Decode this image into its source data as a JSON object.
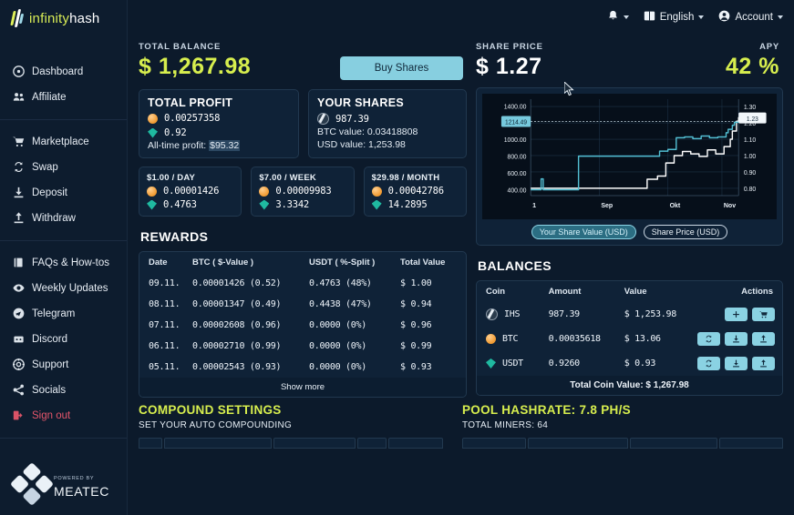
{
  "brand": {
    "name_a": "infinity",
    "name_b": "hash"
  },
  "sidebar": {
    "groups": [
      {
        "items": [
          {
            "label": "Dashboard",
            "icon": "dashboard-icon"
          },
          {
            "label": "Affiliate",
            "icon": "users-icon"
          }
        ]
      },
      {
        "items": [
          {
            "label": "Marketplace",
            "icon": "cart-icon"
          },
          {
            "label": "Swap",
            "icon": "swap-icon"
          },
          {
            "label": "Deposit",
            "icon": "download-icon"
          },
          {
            "label": "Withdraw",
            "icon": "upload-icon"
          }
        ]
      },
      {
        "items": [
          {
            "label": "FAQs & How-tos",
            "icon": "book-icon"
          },
          {
            "label": "Weekly Updates",
            "icon": "eye-icon"
          },
          {
            "label": "Telegram",
            "icon": "telegram-icon"
          },
          {
            "label": "Discord",
            "icon": "discord-icon"
          },
          {
            "label": "Support",
            "icon": "lifebuoy-icon"
          },
          {
            "label": "Socials",
            "icon": "share-icon"
          },
          {
            "label": "Sign out",
            "icon": "signout-icon",
            "danger": true
          }
        ]
      }
    ],
    "footer": {
      "powered_by": "POWERED BY",
      "vendor": "MEATEC"
    }
  },
  "topbar": {
    "notifications_icon": "bell-icon",
    "language": "English",
    "language_icon": "language-icon",
    "account": "Account",
    "account_icon": "user-circle-icon"
  },
  "balance_panel": {
    "label": "TOTAL BALANCE",
    "value": "$ 1,267.98",
    "buy_button": "Buy Shares"
  },
  "share_panel": {
    "label": "SHARE PRICE",
    "value": "$ 1.27",
    "apy_label": "APY",
    "apy_value": "42 %"
  },
  "total_profit": {
    "title": "TOTAL PROFIT",
    "btc": "0.00257358",
    "usdt": "0.92",
    "all_time_label": "All-time profit: ",
    "all_time_value": "$95.32"
  },
  "your_shares": {
    "title": "YOUR SHARES",
    "shares": "987.39",
    "btc_value": "BTC value: 0.03418808",
    "usd_value": "USD value: 1,253.98"
  },
  "rates": [
    {
      "title": "$1.00 / DAY",
      "btc": "0.00001426",
      "usdt": "0.4763"
    },
    {
      "title": "$7.00 / WEEK",
      "btc": "0.00009983",
      "usdt": "3.3342"
    },
    {
      "title": "$29.98 / MONTH",
      "btc": "0.00042786",
      "usdt": "14.2895"
    }
  ],
  "rewards": {
    "title": "REWARDS",
    "columns": [
      "Date",
      "BTC ( $-Value )",
      "USDT ( %-Split )",
      "Total Value"
    ],
    "rows": [
      [
        "09.11.",
        "0.00001426  (0.52)",
        "0.4763  (48%)",
        "$ 1.00"
      ],
      [
        "08.11.",
        "0.00001347  (0.49)",
        "0.4438  (47%)",
        "$ 0.94"
      ],
      [
        "07.11.",
        "0.00002608  (0.96)",
        "0.0000  (0%)",
        "$ 0.96"
      ],
      [
        "06.11.",
        "0.00002710  (0.99)",
        "0.0000  (0%)",
        "$ 0.99"
      ],
      [
        "05.11.",
        "0.00002543  (0.93)",
        "0.0000  (0%)",
        "$ 0.93"
      ]
    ],
    "show_more": "Show more"
  },
  "balances": {
    "title": "BALANCES",
    "columns": [
      "Coin",
      "Amount",
      "Value",
      "Actions"
    ],
    "rows": [
      {
        "coin": "IHS",
        "icon": "ihs-coin-icon",
        "amount": "987.39",
        "value": "$ 1,253.98",
        "actions": [
          "plus-icon",
          "cart-icon"
        ]
      },
      {
        "coin": "BTC",
        "icon": "btc-coin-icon",
        "amount": "0.00035618",
        "value": "$ 13.06",
        "actions": [
          "swap-icon",
          "download-icon",
          "upload-icon"
        ]
      },
      {
        "coin": "USDT",
        "icon": "usdt-coin-icon",
        "amount": "0.9260",
        "value": "$ 0.93",
        "actions": [
          "swap-icon",
          "download-icon",
          "upload-icon"
        ]
      }
    ],
    "total": "Total Coin Value: $ 1,267.98"
  },
  "compound": {
    "title": "COMPOUND SETTINGS",
    "subtitle": "SET YOUR AUTO COMPOUNDING"
  },
  "pool": {
    "title": "POOL HASHRATE: 7.8 PH/S",
    "subtitle": "TOTAL MINERS: 64"
  },
  "colors": {
    "lime": "#d7ee4e",
    "cyan": "#5cc3d6",
    "panel": "#0f2237",
    "background": "#0c1a2b",
    "sidebar": "#0d1c2e",
    "danger": "#e5566b"
  },
  "chart_data": {
    "type": "line",
    "title": "",
    "xlabel": "",
    "ylabel": "",
    "grid": true,
    "legend_position": "bottom",
    "x_ticks": [
      "1",
      "Sep",
      "Okt",
      "Nov"
    ],
    "y_left_ticks": [
      "1400.00",
      "1000.00",
      "800.00",
      "600.00",
      "400.00"
    ],
    "y_right_ticks": [
      "1.30",
      "1.20",
      "1.10",
      "1.00",
      "0.90",
      "0.80"
    ],
    "y_left_range": [
      330,
      1480
    ],
    "y_right_range": [
      0.755,
      1.345
    ],
    "left_marker": {
      "label": "1214.49",
      "value": 1214.49
    },
    "right_marker": {
      "label": "1.23",
      "value": 1.23
    },
    "series": [
      {
        "name": "Your Share Value (USD)",
        "color": "#52bed2",
        "active": true,
        "axis": "left",
        "x": [
          0,
          4,
          5,
          6,
          7,
          8,
          22,
          23,
          58,
          59,
          62,
          63,
          66,
          67,
          70,
          71,
          74,
          75,
          78,
          79,
          82,
          83,
          86,
          87,
          90,
          91,
          94,
          95,
          97,
          98,
          100
        ],
        "values": [
          400,
          400,
          530,
          400,
          400,
          400,
          400,
          800,
          800,
          800,
          860,
          860,
          880,
          880,
          1020,
          1020,
          1030,
          1030,
          1010,
          1010,
          1040,
          1040,
          1020,
          1020,
          1030,
          1030,
          1080,
          1120,
          1170,
          1205,
          1214.49
        ]
      },
      {
        "name": "Share Price (USD)",
        "color": "#ffffff",
        "active": false,
        "axis": "right",
        "x": [
          0,
          55,
          56,
          60,
          61,
          64,
          65,
          68,
          69,
          72,
          73,
          76,
          77,
          80,
          81,
          84,
          85,
          88,
          89,
          92,
          93,
          96,
          97,
          99,
          100
        ],
        "values": [
          0.8,
          0.8,
          0.855,
          0.855,
          0.875,
          0.875,
          0.955,
          0.955,
          1.0,
          1.0,
          1.025,
          1.025,
          1.01,
          1.01,
          0.995,
          0.995,
          1.035,
          1.035,
          1.01,
          1.01,
          1.055,
          1.1,
          1.15,
          1.21,
          1.235
        ]
      }
    ]
  }
}
